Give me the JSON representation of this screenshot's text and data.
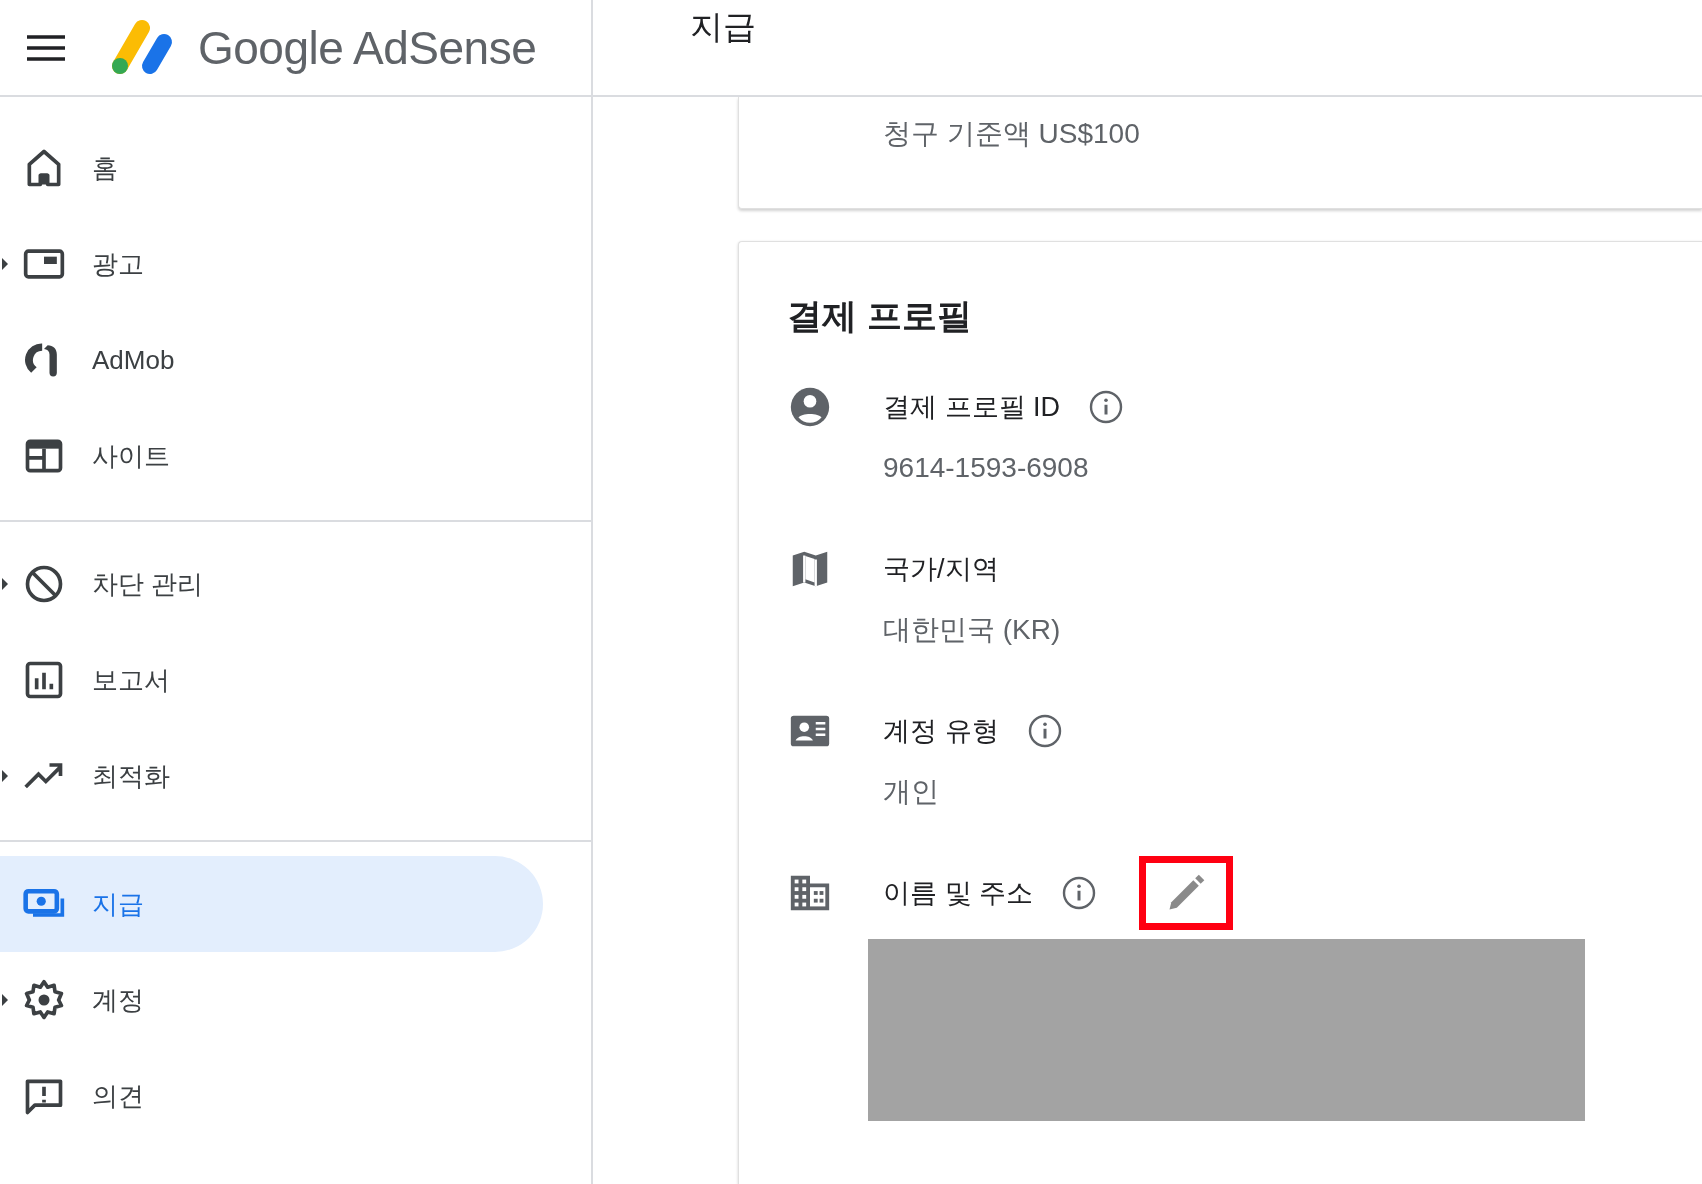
{
  "header": {
    "logo_text": "Google AdSense",
    "page_title": "지급"
  },
  "sidebar": {
    "groups": [
      [
        {
          "kind": "home",
          "label": "홈",
          "expandable": false,
          "selected": false
        },
        {
          "kind": "ads",
          "label": "광고",
          "expandable": true,
          "selected": false
        },
        {
          "kind": "admob",
          "label": "AdMob",
          "expandable": false,
          "selected": false
        },
        {
          "kind": "sites",
          "label": "사이트",
          "expandable": false,
          "selected": false
        }
      ],
      [
        {
          "kind": "block",
          "label": "차단 관리",
          "expandable": true,
          "selected": false
        },
        {
          "kind": "reports",
          "label": "보고서",
          "expandable": false,
          "selected": false
        },
        {
          "kind": "optimize",
          "label": "최적화",
          "expandable": true,
          "selected": false
        }
      ],
      [
        {
          "kind": "payments",
          "label": "지급",
          "expandable": false,
          "selected": true
        },
        {
          "kind": "account",
          "label": "계정",
          "expandable": true,
          "selected": false
        },
        {
          "kind": "feedback",
          "label": "의견",
          "expandable": false,
          "selected": false
        }
      ]
    ]
  },
  "threshold_card": {
    "text": "청구 기준액 US$100"
  },
  "profile_card": {
    "title": "결제 프로필",
    "fields": [
      {
        "kind": "person",
        "label": "결제 프로필 ID",
        "actions": [
          {
            "kind": "info"
          }
        ],
        "value": "9614-1593-6908"
      },
      {
        "kind": "map",
        "label": "국가/지역",
        "value": "대한민국 (KR)"
      },
      {
        "kind": "id_card",
        "label": "계정 유형",
        "actions": [
          {
            "kind": "info"
          }
        ],
        "value": "개인"
      },
      {
        "kind": "building",
        "label": "이름 및 주소",
        "actions": [
          {
            "kind": "info"
          },
          {
            "kind": "edit",
            "highlighted": true
          }
        ]
      }
    ]
  }
}
